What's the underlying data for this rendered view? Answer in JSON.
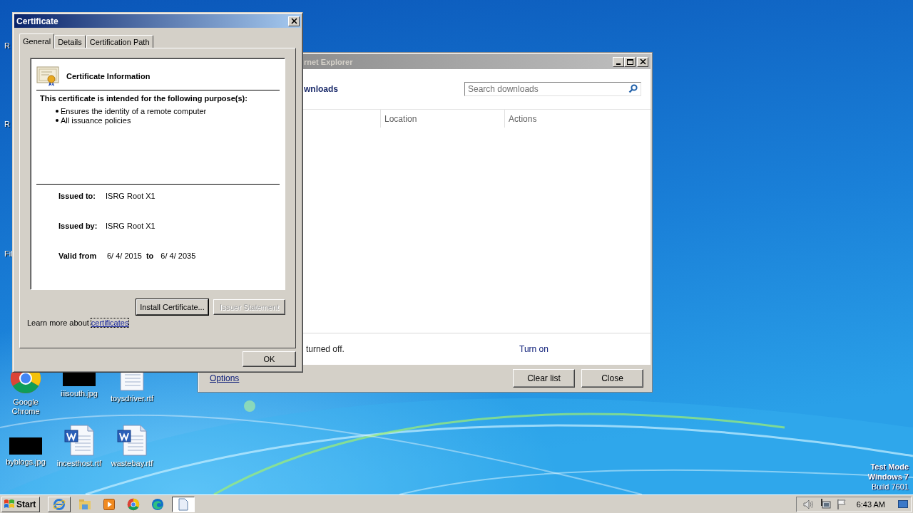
{
  "desktop_icons": [
    {
      "label": "R",
      "kind": "cut"
    },
    {
      "label": "R",
      "kind": "cut"
    },
    {
      "label": "Fil",
      "kind": "cut"
    },
    {
      "label": "Google Chrome",
      "kind": "chrome"
    },
    {
      "label": "iiisouth.jpg"
    },
    {
      "label": "toysdriver.rtf",
      "kind": "text"
    },
    {
      "label": "byblogs.jpg"
    },
    {
      "label": "incesthost.rtf",
      "kind": "word"
    },
    {
      "label": "wastebay.rtf",
      "kind": "word"
    }
  ],
  "downloads_window": {
    "title": "rnet Explorer",
    "heading": "wnloads",
    "search": {
      "placeholder": "Search downloads"
    },
    "columns": [
      "Location",
      "Actions"
    ],
    "notice": "turned off.",
    "notice_link": "Turn on",
    "options_link": "Options",
    "buttons": [
      "Clear list",
      "Close"
    ]
  },
  "certificate_dialog": {
    "title": "Certificate",
    "tabs": [
      {
        "label": "General",
        "selected": true
      },
      {
        "label": "Details",
        "selected": false
      },
      {
        "label": "Certification Path",
        "selected": false
      }
    ],
    "info_title": "Certificate Information",
    "purpose_heading": "This certificate is intended for the following purpose(s):",
    "purposes": [
      "Ensures the identity of a remote computer",
      "All issuance policies"
    ],
    "fields": [
      {
        "label": "Issued to:",
        "value": "ISRG Root X1"
      },
      {
        "label": "Issued by:",
        "value": "ISRG Root X1"
      }
    ],
    "validity": {
      "label": "Valid from",
      "from": "6/ 4/ 2015",
      "to_label": "to",
      "to": "6/ 4/ 2035"
    },
    "buttons": [
      {
        "label": "Install Certificate...",
        "disabled": false,
        "focused": true
      },
      {
        "label": "Issuer Statement",
        "disabled": true,
        "focused": false
      }
    ],
    "learn_more": {
      "text": "Learn more about",
      "link": "certificates"
    },
    "ok_button": "OK"
  },
  "desktop_notice": [
    "Test Mode",
    "Windows 7",
    "Build 7601"
  ],
  "taskbar": {
    "start": "Start",
    "apps": [
      {
        "kind": "ie",
        "running": true,
        "selected": false
      },
      {
        "kind": "explorer",
        "running": false,
        "selected": false
      },
      {
        "kind": "media",
        "running": false,
        "selected": false
      },
      {
        "kind": "chrome",
        "running": false,
        "selected": false
      },
      {
        "kind": "edge",
        "running": false,
        "selected": false
      },
      {
        "kind": "document",
        "running": true,
        "selected": true
      }
    ],
    "clock": "6:43 AM"
  }
}
